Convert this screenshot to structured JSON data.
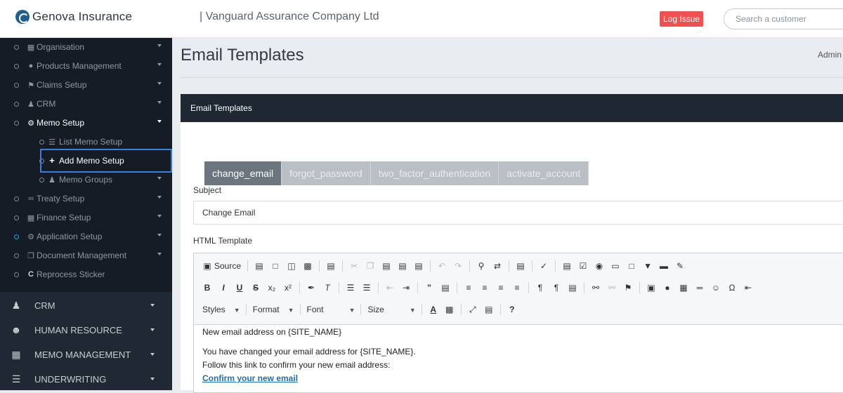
{
  "header": {
    "brand_name": "Genova Insurance",
    "company": "| Vanguard Assurance Company Ltd",
    "log_issue": "Log Issue",
    "search_placeholder": "Search a customer"
  },
  "sidebar": {
    "sub_items": [
      {
        "label": "Organisation",
        "icon": "building-icon"
      },
      {
        "label": "Products Management",
        "icon": "product-icon"
      },
      {
        "label": "Claims Setup",
        "icon": "claims-icon"
      },
      {
        "label": "CRM",
        "icon": "crm-icon"
      },
      {
        "label": "Memo Setup",
        "icon": "gear-icon"
      },
      {
        "label": "List Memo Setup",
        "icon": "list-icon"
      },
      {
        "label": "Add Memo Setup",
        "icon": "plus-icon"
      },
      {
        "label": "Memo Groups",
        "icon": "users-icon"
      },
      {
        "label": "Treaty Setup",
        "icon": "treaty-icon"
      },
      {
        "label": "Finance Setup",
        "icon": "finance-icon"
      },
      {
        "label": "Application Setup",
        "icon": "gear-icon"
      },
      {
        "label": "Document Management",
        "icon": "document-icon"
      },
      {
        "label": "Reprocess Sticker",
        "icon": "refresh-icon"
      }
    ],
    "main_items": [
      {
        "label": "CRM",
        "icon": "crm-icon"
      },
      {
        "label": "HUMAN RESOURCE",
        "icon": "users-icon"
      },
      {
        "label": "MEMO MANAGEMENT",
        "icon": "memo-icon"
      },
      {
        "label": "UNDERWRITING",
        "icon": "underwriting-icon"
      }
    ]
  },
  "page": {
    "title": "Email Templates",
    "admin": "Admin"
  },
  "panel": {
    "heading": "Email Templates",
    "tabs": [
      "change_email",
      "forgot_password",
      "two_factor_authentication",
      "activate_account"
    ],
    "subject_label": "Subject",
    "subject_value": "Change Email",
    "html_label": "HTML Template"
  },
  "editor": {
    "source_label": "Source",
    "styles": "Styles",
    "format": "Format",
    "font": "Font",
    "size": "Size",
    "content": {
      "line1": "New email address on {SITE_NAME}",
      "line2": "You have changed your email address for {SITE_NAME}.",
      "line3": "Follow this link to confirm your new email address:",
      "link": "Confirm your new email"
    }
  },
  "colors": {
    "sidebar_bg": "#1f2833",
    "panel_head_bg": "#1e2732",
    "log_issue_bg": "#f05050",
    "active_tab": "#6c757d",
    "link": "#1a6fb5"
  }
}
